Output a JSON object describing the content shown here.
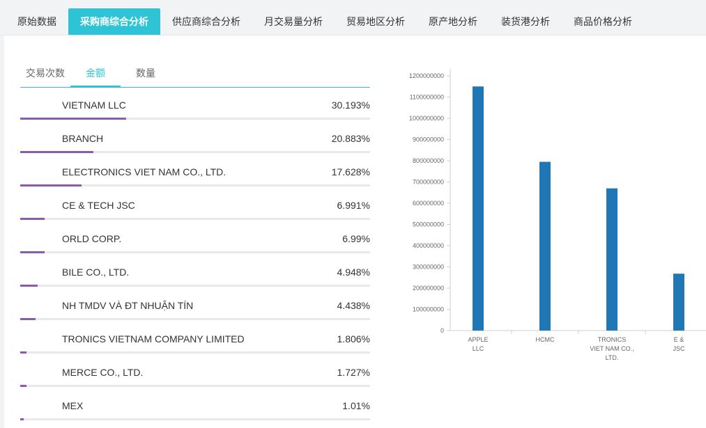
{
  "top_tabs": [
    {
      "label": "原始数据",
      "active": false
    },
    {
      "label": "采购商综合分析",
      "active": true
    },
    {
      "label": "供应商综合分析",
      "active": false
    },
    {
      "label": "月交易量分析",
      "active": false
    },
    {
      "label": "贸易地区分析",
      "active": false
    },
    {
      "label": "原产地分析",
      "active": false
    },
    {
      "label": "装货港分析",
      "active": false
    },
    {
      "label": "商品价格分析",
      "active": false
    }
  ],
  "sub_tabs": [
    {
      "label": "交易次数",
      "active": false
    },
    {
      "label": "金额",
      "active": true
    },
    {
      "label": "数量",
      "active": false
    }
  ],
  "rows": [
    {
      "name": "VIETNAM LLC",
      "pct_label": "30.193%",
      "pct": 30.193
    },
    {
      "name": "BRANCH",
      "pct_label": "20.883%",
      "pct": 20.883
    },
    {
      "name": "ELECTRONICS VIET NAM CO., LTD.",
      "pct_label": "17.628%",
      "pct": 17.628
    },
    {
      "name": "CE & TECH JSC",
      "pct_label": "6.991%",
      "pct": 6.991
    },
    {
      "name": "ORLD CORP.",
      "pct_label": "6.99%",
      "pct": 6.99
    },
    {
      "name": "BILE CO., LTD.",
      "pct_label": "4.948%",
      "pct": 4.948
    },
    {
      "name": "NH TMDV VÀ ĐT NHUẬN TÍN",
      "pct_label": "4.438%",
      "pct": 4.438
    },
    {
      "name": "TRONICS VIETNAM COMPANY LIMITED",
      "pct_label": "1.806%",
      "pct": 1.806
    },
    {
      "name": "MERCE CO., LTD.",
      "pct_label": "1.727%",
      "pct": 1.727
    },
    {
      "name": "MEX",
      "pct_label": "1.01%",
      "pct": 1.01
    }
  ],
  "colors": {
    "accent": "#2ec4d6",
    "progress": "#8e5ab0",
    "bar": "#1f77b4"
  },
  "chart_data": {
    "type": "bar",
    "categories": [
      [
        "APPLE",
        "LLC"
      ],
      [
        "HCMC"
      ],
      [
        "TRONICS",
        "VIET NAM CO.,",
        "LTD."
      ],
      [
        "E &",
        "JSC"
      ]
    ],
    "values": [
      1150000000,
      795000000,
      670000000,
      268000000
    ],
    "yticks": [
      "0",
      "100000000",
      "200000000",
      "300000000",
      "400000000",
      "500000000",
      "600000000",
      "700000000",
      "800000000",
      "900000000",
      "1000000000",
      "1100000000",
      "1200000000"
    ],
    "ylim": [
      0,
      1200000000
    ],
    "grid": false
  }
}
